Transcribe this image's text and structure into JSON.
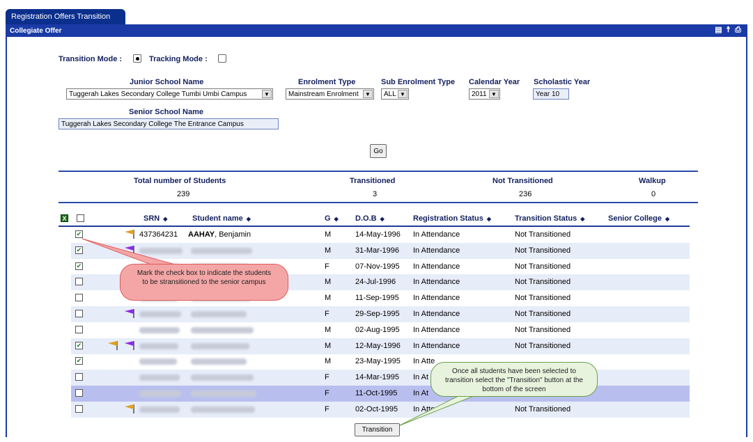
{
  "tab": {
    "label": "Registration Offers Transition"
  },
  "titlebar": {
    "title": "Collegiate Offer"
  },
  "modes": {
    "transition_label": "Transition Mode :",
    "tracking_label": "Tracking Mode :",
    "transition_selected": true
  },
  "filters": {
    "junior_school_label": "Junior School Name",
    "junior_school_value": "Tuggerah Lakes Secondary College Tumbi Umbi Campus",
    "enrolment_type_label": "Enrolment Type",
    "enrolment_type_value": "Mainstream Enrolment",
    "sub_enrolment_label": "Sub Enrolment Type",
    "sub_enrolment_value": "ALL",
    "calendar_year_label": "Calendar Year",
    "calendar_year_value": "2011",
    "scholastic_year_label": "Scholastic Year",
    "scholastic_year_value": "Year 10",
    "senior_school_label": "Senior School Name",
    "senior_school_value": "Tuggerah Lakes Secondary College The Entrance Campus",
    "go_label": "Go"
  },
  "stats": {
    "total_label": "Total number of Students",
    "total_value": "239",
    "transitioned_label": "Transitioned",
    "transitioned_value": "3",
    "not_transitioned_label": "Not Transitioned",
    "not_transitioned_value": "236",
    "walkup_label": "Walkup",
    "walkup_value": "0"
  },
  "columns": {
    "srn": "SRN",
    "name": "Student name",
    "gender": "G",
    "dob": "D.O.B",
    "registration": "Registration Status",
    "transition": "Transition Status",
    "senior_college": "Senior College"
  },
  "rows": [
    {
      "checked": true,
      "srn": "437364231",
      "surname": "AAHAY",
      "given": ", Benjamin",
      "g": "M",
      "dob": "14-May-1996",
      "reg": "In Attendance",
      "trans": "Not Transitioned",
      "flags": [
        "orange"
      ]
    },
    {
      "checked": true,
      "srn": "",
      "g": "M",
      "dob": "31-Mar-1996",
      "reg": "In Attendance",
      "trans": "Not Transitioned",
      "flags": [
        "purple"
      ]
    },
    {
      "checked": true,
      "srn": "",
      "g": "F",
      "dob": "07-Nov-1995",
      "reg": "In Attendance",
      "trans": "Not Transitioned",
      "flags": []
    },
    {
      "checked": false,
      "srn": "",
      "g": "M",
      "dob": "24-Jul-1996",
      "reg": "In Attendance",
      "trans": "Not Transitioned",
      "flags": []
    },
    {
      "checked": false,
      "srn": "",
      "g": "M",
      "dob": "11-Sep-1995",
      "reg": "In Attendance",
      "trans": "Not Transitioned",
      "flags": []
    },
    {
      "checked": false,
      "srn": "",
      "g": "F",
      "dob": "29-Sep-1995",
      "reg": "In Attendance",
      "trans": "Not Transitioned",
      "flags": [
        "purple"
      ]
    },
    {
      "checked": false,
      "srn": "",
      "g": "M",
      "dob": "02-Aug-1995",
      "reg": "In Attendance",
      "trans": "Not Transitioned",
      "flags": []
    },
    {
      "checked": true,
      "srn": "",
      "g": "M",
      "dob": "12-May-1996",
      "reg": "In Attendance",
      "trans": "Not Transitioned",
      "flags": [
        "orange",
        "purple"
      ]
    },
    {
      "checked": true,
      "srn": "",
      "g": "M",
      "dob": "23-May-1995",
      "reg": "In Atte",
      "trans": "",
      "flags": []
    },
    {
      "checked": false,
      "srn": "",
      "g": "F",
      "dob": "14-Mar-1995",
      "reg": "In At",
      "trans": "",
      "flags": []
    },
    {
      "checked": false,
      "srn": "",
      "g": "F",
      "dob": "11-Oct-1995",
      "reg": "In At",
      "trans": "",
      "flags": []
    },
    {
      "checked": false,
      "srn": "",
      "g": "F",
      "dob": "02-Oct-1995",
      "reg": "In Atte",
      "trans": "Not Transitioned",
      "flags": [
        "orange"
      ]
    }
  ],
  "transition_button": "Transition",
  "callouts": {
    "checkbox_note": "Mark the check box to indicate the students to be stransitioned to the senior campus",
    "button_note": "Once all students have been selected to transition select the \"Transition\" button at the bottom of the screen"
  },
  "colors": {
    "header_bg": "#1a3aa6",
    "tab_bg": "#0b2f8c",
    "alt_row": "#e6ecf8",
    "selected_row": "#b8bfee",
    "callout_red": "#f4a6a6",
    "callout_green": "#e8f3de"
  }
}
